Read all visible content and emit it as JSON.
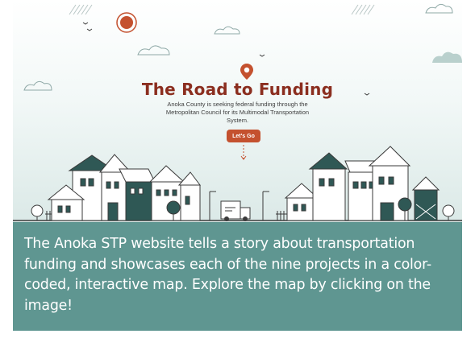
{
  "hero": {
    "title": "The Road to Funding",
    "description": "Anoka County is seeking federal funding through the Metropolitan Council for its Multimodal Transportation System.",
    "cta_label": "Let's Go"
  },
  "caption": {
    "text": "The Anoka STP website tells a story about transportation funding and showcases each of the nine projects in a color-coded, interactive map. Explore the map by clicking on the image!"
  },
  "colors": {
    "title": "#8b2e1f",
    "accent": "#c4512f",
    "caption_bg": "#5f9691",
    "house_dark": "#2f5855",
    "line": "#3a3a3a"
  },
  "icons": [
    "sun-icon",
    "location-pin-icon",
    "arrow-down-icon",
    "cloud-icon",
    "bird-icon",
    "house-icon",
    "tree-icon",
    "streetlight-icon",
    "delivery-truck-icon",
    "fence-icon"
  ]
}
